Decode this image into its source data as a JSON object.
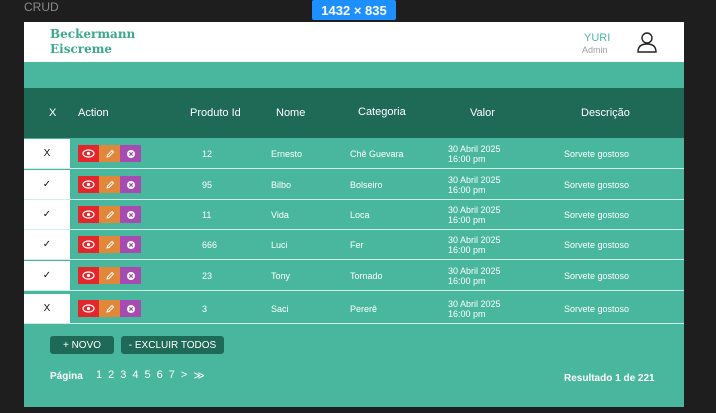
{
  "canvas": {
    "label": "CRUD",
    "dimensions": "1432 × 835"
  },
  "brand": {
    "line1": "Beckermann",
    "line2": "Eiscreme"
  },
  "user": {
    "name": "YURI",
    "role": "Admin",
    "icon": "user-icon"
  },
  "table": {
    "headers": {
      "select": "X",
      "action": "Action",
      "id": "Produto Id",
      "name": "Nome",
      "category": "Categoria",
      "value": "Valor",
      "desc": "Descrição"
    },
    "rows": [
      {
        "check": "X",
        "id": "12",
        "name": "Ernesto",
        "category": "Chê Guevara",
        "date": "30 Abril 2025",
        "time": "16:00 pm",
        "desc": "Sorvete gostoso"
      },
      {
        "check": "✓",
        "id": "95",
        "name": "Bilbo",
        "category": "Bolseiro",
        "date": "30 Abril 2025",
        "time": "16:00 pm",
        "desc": "Sorvete gostoso"
      },
      {
        "check": "✓",
        "id": "11",
        "name": "Vida",
        "category": "Loca",
        "date": "30 Abril 2025",
        "time": "16:00 pm",
        "desc": "Sorvete gostoso"
      },
      {
        "check": "✓",
        "id": "666",
        "name": "Luci",
        "category": "Fer",
        "date": "30 Abril 2025",
        "time": "16:00 pm",
        "desc": "Sorvete gostoso"
      },
      {
        "check": "✓",
        "id": "23",
        "name": "Tony",
        "category": "Tornado",
        "date": "30 Abril 2025",
        "time": "16:00 pm",
        "desc": "Sorvete gostoso"
      },
      {
        "check": "X",
        "id": "3",
        "name": "Saci",
        "category": "Pererê",
        "date": "30 Abril 2025",
        "time": "16:00 pm",
        "desc": "Sorvete gostoso"
      }
    ],
    "action_icons": [
      "eye-icon",
      "pencil-icon",
      "close-circle-icon"
    ]
  },
  "buttons": {
    "new": "+ NOVO",
    "delete_all": "- EXCLUIR TODOS"
  },
  "pagination": {
    "label": "Página",
    "pages": [
      "1",
      "2",
      "3",
      "4",
      "5",
      "6",
      "7"
    ],
    "next": ">",
    "last": "≫"
  },
  "result": "Resultado 1 de 221",
  "colors": {
    "primary": "#48b79e",
    "dark": "#1f6a56",
    "view": "#e2262b",
    "edit": "#e0873a",
    "delete": "#a64bb0"
  }
}
